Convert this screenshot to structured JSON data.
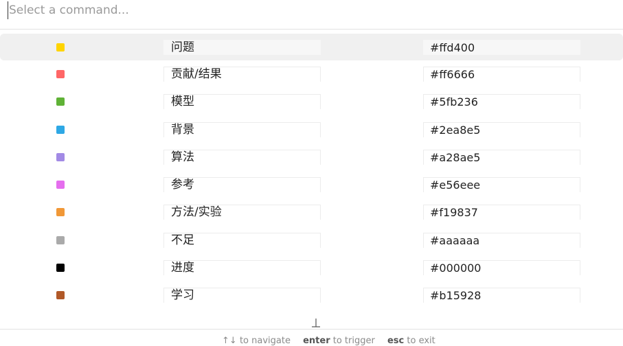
{
  "search": {
    "placeholder": "Select a command...",
    "value": ""
  },
  "items": [
    {
      "name": "问题",
      "color": "#ffd400",
      "selected": true
    },
    {
      "name": "贡献/结果",
      "color": "#ff6666",
      "selected": false
    },
    {
      "name": "模型",
      "color": "#5fb236",
      "selected": false
    },
    {
      "name": "背景",
      "color": "#2ea8e5",
      "selected": false
    },
    {
      "name": "算法",
      "color": "#a28ae5",
      "selected": false
    },
    {
      "name": "参考",
      "color": "#e56eee",
      "selected": false
    },
    {
      "name": "方法/实验",
      "color": "#f19837",
      "selected": false
    },
    {
      "name": "不足",
      "color": "#aaaaaa",
      "selected": false
    },
    {
      "name": "进度",
      "color": "#000000",
      "selected": false
    },
    {
      "name": "学习",
      "color": "#b15928",
      "selected": false
    }
  ],
  "footer": {
    "navigate_key": "↑↓",
    "navigate_label": "to navigate",
    "trigger_key": "enter",
    "trigger_label": "to trigger",
    "exit_key": "esc",
    "exit_label": "to exit"
  }
}
